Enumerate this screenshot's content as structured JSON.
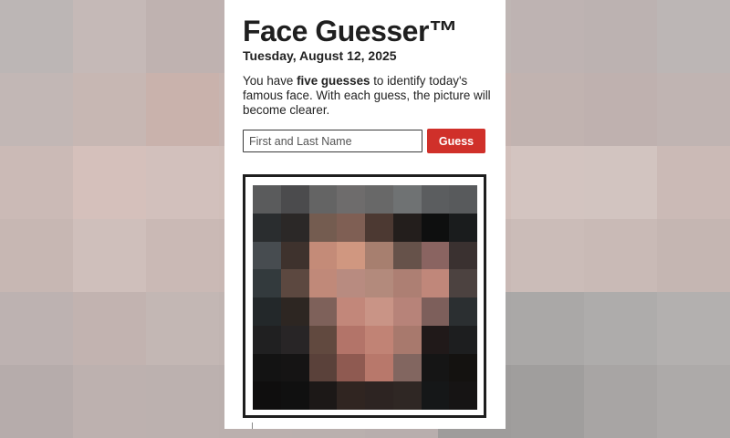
{
  "header": {
    "title": "Face Guesser™",
    "date": "Tuesday, August 12, 2025"
  },
  "intro": {
    "before": "You have ",
    "emphasis": "five guesses",
    "after": " to identify today's famous face. With each guess, the picture will become clearer."
  },
  "guess_form": {
    "placeholder": "First and Last Name",
    "value": "",
    "button_label": "Guess"
  },
  "colors": {
    "accent": "#d0302a",
    "panel_background": "#ffffff"
  },
  "pixelated_face": [
    [
      "#5a5b5c",
      "#4b4b4d",
      "#646464",
      "#6e6c6c",
      "#686868",
      "#6f7273",
      "#5b5d5f",
      "#585a5c"
    ],
    [
      "#2a2d2f",
      "#2b2827",
      "#745c50",
      "#7f5f54",
      "#4c3932",
      "#231e1c",
      "#0e0f0f",
      "#1a1c1d"
    ],
    [
      "#474c50",
      "#3e322d",
      "#c48b78",
      "#d09780",
      "#a77f6f",
      "#66524a",
      "#8a6461",
      "#3a3130"
    ],
    [
      "#333a3d",
      "#5c4840",
      "#c08979",
      "#b88b80",
      "#b38a7c",
      "#ad7f73",
      "#c0877a",
      "#4c4240"
    ],
    [
      "#23282a",
      "#2d2622",
      "#7e615a",
      "#c2877a",
      "#c99486",
      "#b78379",
      "#7d5f5b",
      "#2b2f31"
    ],
    [
      "#202021",
      "#282526",
      "#61493f",
      "#b37469",
      "#c18375",
      "#a8796d",
      "#201919",
      "#1d1e1f"
    ],
    [
      "#131313",
      "#151414",
      "#5a413a",
      "#8f5a51",
      "#b8786b",
      "#826660",
      "#151515",
      "#141210"
    ],
    [
      "#0f0e0e",
      "#101010",
      "#1c1817",
      "#302521",
      "#2d2422",
      "#2f2724",
      "#151718",
      "#161414"
    ]
  ],
  "background_pixels": [
    [
      "#bcb6b5",
      "#c5b9b7",
      "#bfb2b0",
      "#bfb2b1",
      "#c2b7b5",
      "#c1b9b8",
      "#bfb6b4",
      "#beb3b2",
      "#bcb2b1",
      "#bcb6b5"
    ],
    [
      "#c2b7b5",
      "#c7b7b3",
      "#c9b2ac",
      "#c7b5b1",
      "#c5b6b2",
      "#bdb4b3",
      "#c5b3af",
      "#c1b3b0",
      "#bfb1af",
      "#c0b4b2"
    ],
    [
      "#cbbab6",
      "#d5c0bb",
      "#d2c0bc",
      "#d1bfba",
      "#cfbfba",
      "#cfc0bb",
      "#d2c0bb",
      "#d3c4c0",
      "#d2c4c0",
      "#cbbab6"
    ],
    [
      "#c7b7b3",
      "#cfbfbb",
      "#cab9b5",
      "#c9b8b4",
      "#c9b9b5",
      "#c9b8b4",
      "#c9b9b5",
      "#cbbcb8",
      "#c9bab6",
      "#c5b6b2"
    ],
    [
      "#bdb2b1",
      "#c2b3b0",
      "#c3b7b4",
      "#c1b5b2",
      "#c3b7b4",
      "#c4b9b6",
      "#a9a7a6",
      "#aaa8a7",
      "#aeacab",
      "#b3b0af"
    ],
    [
      "#b6acab",
      "#bdb1af",
      "#bcb1af",
      "#bbb0ae",
      "#bab0ae",
      "#b8aead",
      "#9e9c9b",
      "#a09e9d",
      "#a8a5a4",
      "#adaaa9"
    ]
  ]
}
